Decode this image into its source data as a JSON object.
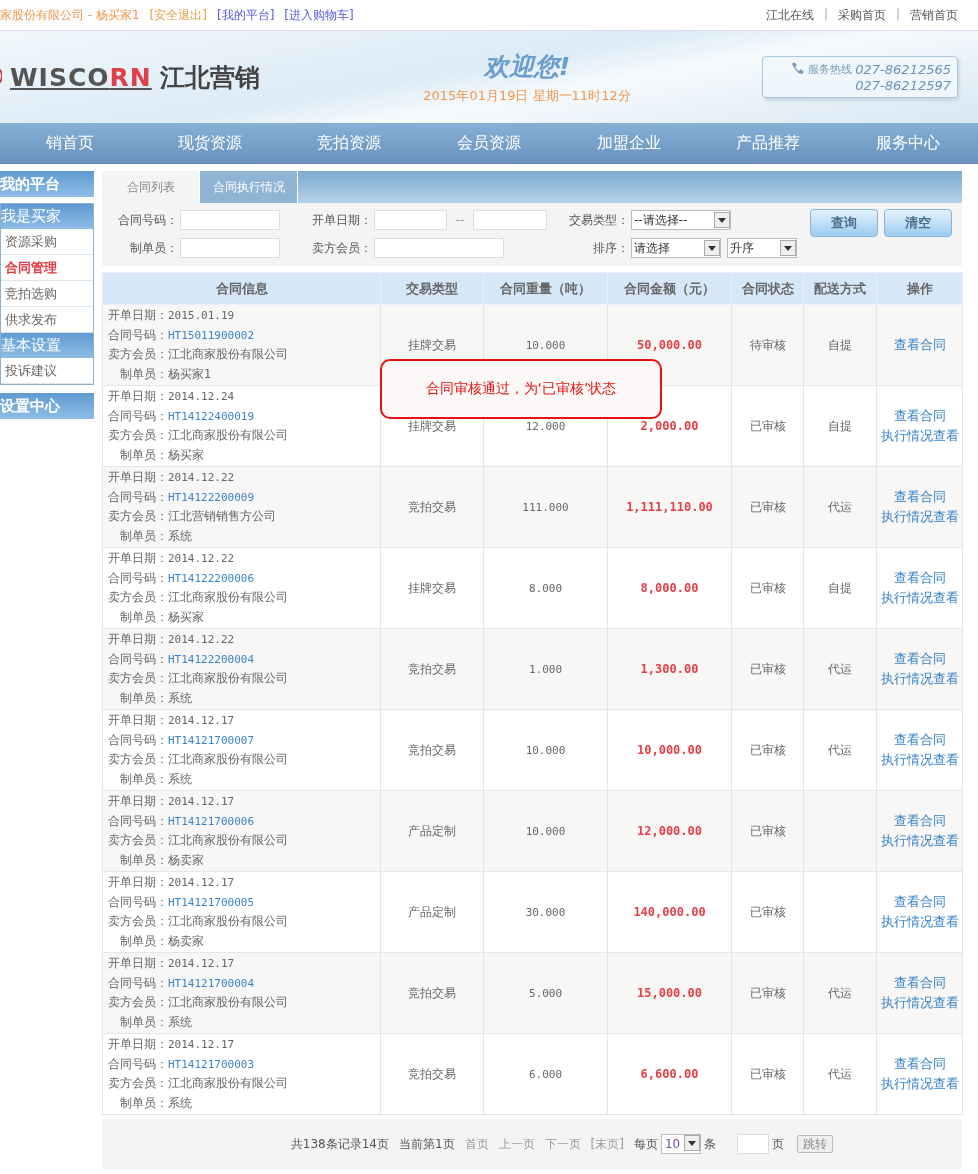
{
  "top_bar": {
    "user_info": "家股份有限公司 - 杨买家1",
    "links": [
      "[安全退出]",
      "[我的平台]",
      "[进入购物车]"
    ],
    "right_links": [
      "江北在线",
      "采购首页",
      "营销首页"
    ],
    "separators": [
      "|",
      "|"
    ]
  },
  "header": {
    "logo": {
      "brand": "WISCO",
      "brand_accent": "RN",
      "name": "江北营销"
    },
    "welcome": "欢迎您!",
    "datetime": "2015年01月19日 星期一11时12分",
    "hotline": {
      "label": "服务热线",
      "numbers": [
        "027-86212565",
        "027-86212597"
      ]
    }
  },
  "nav": [
    "销首页",
    "现货资源",
    "竞拍资源",
    "会员资源",
    "加盟企业",
    "产品推荐",
    "服务中心"
  ],
  "sidebar": {
    "title": "我的平台",
    "groups": [
      {
        "title": "我是买家",
        "items": [
          {
            "label": "资源采购",
            "selected": false
          },
          {
            "label": "合同管理",
            "selected": true
          },
          {
            "label": "竞拍选购",
            "selected": false
          },
          {
            "label": "供求发布",
            "selected": false
          }
        ]
      },
      {
        "title": "基本设置",
        "items": [
          {
            "label": "投诉建议",
            "selected": false
          }
        ]
      }
    ],
    "footer": "设置中心"
  },
  "tabs": [
    {
      "label": "合同列表",
      "selected": true
    },
    {
      "label": "合同执行情况",
      "selected": false
    }
  ],
  "filters": {
    "contract_no": {
      "label": "合同号码："
    },
    "date": {
      "label": "开单日期：",
      "separator": "--"
    },
    "trade_type": {
      "label": "交易类型：",
      "value": "--请选择--"
    },
    "creator": {
      "label": "制单员："
    },
    "seller": {
      "label": "卖方会员："
    },
    "sort": {
      "label": "排序：",
      "field": "请选择",
      "order": "升序"
    },
    "buttons": [
      "查询",
      "清空"
    ]
  },
  "table": {
    "columns": [
      "合同信息",
      "交易类型",
      "合同重量（吨）",
      "合同金额（元）",
      "合同状态",
      "配送方式",
      "操作"
    ],
    "rows": [
      {
        "info": [
          {
            "label": "开单日期：",
            "value": "2015.01.19"
          },
          {
            "label": "合同号码：",
            "value": "HT15011900002",
            "kind": "link"
          },
          {
            "label": "卖方会员：",
            "value": "江北商家股份有限公司"
          },
          {
            "label": "制单员：",
            "value": "杨买家1"
          }
        ],
        "trade_type": "挂牌交易",
        "weight": "10.000",
        "amount": "50,000.00",
        "status": "待审核",
        "delivery": "自提",
        "actions": [
          "查看合同"
        ]
      },
      {
        "info": [
          {
            "label": "开单日期：",
            "value": "2014.12.24"
          },
          {
            "label": "合同号码：",
            "value": "HT14122400019",
            "kind": "link"
          },
          {
            "label": "卖方会员：",
            "value": "江北商家股份有限公司"
          },
          {
            "label": "制单员：",
            "value": "杨买家"
          }
        ],
        "trade_type": "挂牌交易",
        "weight": "12.000",
        "amount": "2,000.00",
        "status": "已审核",
        "delivery": "自提",
        "actions": [
          "查看合同",
          "执行情况查看"
        ]
      },
      {
        "info": [
          {
            "label": "开单日期：",
            "value": "2014.12.22"
          },
          {
            "label": "合同号码：",
            "value": "HT14122200009",
            "kind": "link"
          },
          {
            "label": "卖方会员：",
            "value": "江北营销销售方公司"
          },
          {
            "label": "制单员：",
            "value": "系统"
          }
        ],
        "trade_type": "竞拍交易",
        "weight": "111.000",
        "amount": "1,111,110.00",
        "status": "已审核",
        "delivery": "代运",
        "actions": [
          "查看合同",
          "执行情况查看"
        ]
      },
      {
        "info": [
          {
            "label": "开单日期：",
            "value": "2014.12.22"
          },
          {
            "label": "合同号码：",
            "value": "HT14122200006",
            "kind": "link"
          },
          {
            "label": "卖方会员：",
            "value": "江北商家股份有限公司"
          },
          {
            "label": "制单员：",
            "value": "杨买家"
          }
        ],
        "trade_type": "挂牌交易",
        "weight": "8.000",
        "amount": "8,000.00",
        "status": "已审核",
        "delivery": "自提",
        "actions": [
          "查看合同",
          "执行情况查看"
        ]
      },
      {
        "info": [
          {
            "label": "开单日期：",
            "value": "2014.12.22"
          },
          {
            "label": "合同号码：",
            "value": "HT14122200004",
            "kind": "link"
          },
          {
            "label": "卖方会员：",
            "value": "江北商家股份有限公司"
          },
          {
            "label": "制单员：",
            "value": "系统"
          }
        ],
        "trade_type": "竞拍交易",
        "weight": "1.000",
        "amount": "1,300.00",
        "status": "已审核",
        "delivery": "代运",
        "actions": [
          "查看合同",
          "执行情况查看"
        ]
      },
      {
        "info": [
          {
            "label": "开单日期：",
            "value": "2014.12.17"
          },
          {
            "label": "合同号码：",
            "value": "HT14121700007",
            "kind": "link"
          },
          {
            "label": "卖方会员：",
            "value": "江北商家股份有限公司"
          },
          {
            "label": "制单员：",
            "value": "系统"
          }
        ],
        "trade_type": "竞拍交易",
        "weight": "10.000",
        "amount": "10,000.00",
        "status": "已审核",
        "delivery": "代运",
        "actions": [
          "查看合同",
          "执行情况查看"
        ]
      },
      {
        "info": [
          {
            "label": "开单日期：",
            "value": "2014.12.17"
          },
          {
            "label": "合同号码：",
            "value": "HT14121700006",
            "kind": "link"
          },
          {
            "label": "卖方会员：",
            "value": "江北商家股份有限公司"
          },
          {
            "label": "制单员：",
            "value": "杨卖家"
          }
        ],
        "trade_type": "产品定制",
        "weight": "10.000",
        "amount": "12,000.00",
        "status": "已审核",
        "actions": [
          "查看合同",
          "执行情况查看"
        ]
      },
      {
        "info": [
          {
            "label": "开单日期：",
            "value": "2014.12.17"
          },
          {
            "label": "合同号码：",
            "value": "HT14121700005",
            "kind": "link"
          },
          {
            "label": "卖方会员：",
            "value": "江北商家股份有限公司"
          },
          {
            "label": "制单员：",
            "value": "杨卖家"
          }
        ],
        "trade_type": "产品定制",
        "weight": "30.000",
        "amount": "140,000.00",
        "status": "已审核",
        "actions": [
          "查看合同",
          "执行情况查看"
        ]
      },
      {
        "info": [
          {
            "label": "开单日期：",
            "value": "2014.12.17"
          },
          {
            "label": "合同号码：",
            "value": "HT14121700004",
            "kind": "link"
          },
          {
            "label": "卖方会员：",
            "value": "江北商家股份有限公司"
          },
          {
            "label": "制单员：",
            "value": "系统"
          }
        ],
        "trade_type": "竞拍交易",
        "weight": "5.000",
        "amount": "15,000.00",
        "status": "已审核",
        "delivery": "代运",
        "actions": [
          "查看合同",
          "执行情况查看"
        ]
      },
      {
        "info": [
          {
            "label": "开单日期：",
            "value": "2014.12.17"
          },
          {
            "label": "合同号码：",
            "value": "HT14121700003",
            "kind": "link"
          },
          {
            "label": "卖方会员：",
            "value": "江北商家股份有限公司"
          },
          {
            "label": "制单员：",
            "value": "系统"
          }
        ],
        "trade_type": "竞拍交易",
        "weight": "6.000",
        "amount": "6,600.00",
        "status": "已审核",
        "delivery": "代运",
        "actions": [
          "查看合同",
          "执行情况查看"
        ]
      }
    ]
  },
  "toast": "合同审核通过，为‘已审核’状态",
  "pagination": {
    "summary": "共138条记录14页",
    "current": "当前第1页",
    "links": [
      "首页",
      "上一页",
      "下一页",
      "[末页]"
    ],
    "per_page_label": "每页",
    "per_page": "10",
    "per_page_unit": "条",
    "page_unit": "页",
    "jump": "跳转"
  }
}
